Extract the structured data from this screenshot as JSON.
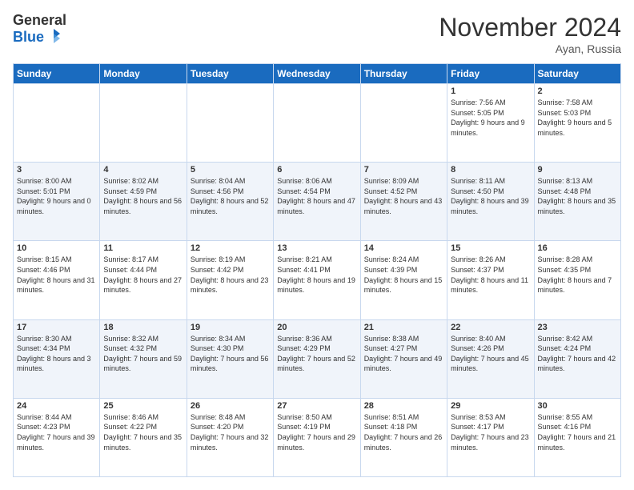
{
  "header": {
    "logo_general": "General",
    "logo_blue": "Blue",
    "title": "November 2024",
    "location": "Ayan, Russia"
  },
  "days_of_week": [
    "Sunday",
    "Monday",
    "Tuesday",
    "Wednesday",
    "Thursday",
    "Friday",
    "Saturday"
  ],
  "weeks": [
    [
      {
        "day": "",
        "info": ""
      },
      {
        "day": "",
        "info": ""
      },
      {
        "day": "",
        "info": ""
      },
      {
        "day": "",
        "info": ""
      },
      {
        "day": "",
        "info": ""
      },
      {
        "day": "1",
        "info": "Sunrise: 7:56 AM\nSunset: 5:05 PM\nDaylight: 9 hours and 9 minutes."
      },
      {
        "day": "2",
        "info": "Sunrise: 7:58 AM\nSunset: 5:03 PM\nDaylight: 9 hours and 5 minutes."
      }
    ],
    [
      {
        "day": "3",
        "info": "Sunrise: 8:00 AM\nSunset: 5:01 PM\nDaylight: 9 hours and 0 minutes."
      },
      {
        "day": "4",
        "info": "Sunrise: 8:02 AM\nSunset: 4:59 PM\nDaylight: 8 hours and 56 minutes."
      },
      {
        "day": "5",
        "info": "Sunrise: 8:04 AM\nSunset: 4:56 PM\nDaylight: 8 hours and 52 minutes."
      },
      {
        "day": "6",
        "info": "Sunrise: 8:06 AM\nSunset: 4:54 PM\nDaylight: 8 hours and 47 minutes."
      },
      {
        "day": "7",
        "info": "Sunrise: 8:09 AM\nSunset: 4:52 PM\nDaylight: 8 hours and 43 minutes."
      },
      {
        "day": "8",
        "info": "Sunrise: 8:11 AM\nSunset: 4:50 PM\nDaylight: 8 hours and 39 minutes."
      },
      {
        "day": "9",
        "info": "Sunrise: 8:13 AM\nSunset: 4:48 PM\nDaylight: 8 hours and 35 minutes."
      }
    ],
    [
      {
        "day": "10",
        "info": "Sunrise: 8:15 AM\nSunset: 4:46 PM\nDaylight: 8 hours and 31 minutes."
      },
      {
        "day": "11",
        "info": "Sunrise: 8:17 AM\nSunset: 4:44 PM\nDaylight: 8 hours and 27 minutes."
      },
      {
        "day": "12",
        "info": "Sunrise: 8:19 AM\nSunset: 4:42 PM\nDaylight: 8 hours and 23 minutes."
      },
      {
        "day": "13",
        "info": "Sunrise: 8:21 AM\nSunset: 4:41 PM\nDaylight: 8 hours and 19 minutes."
      },
      {
        "day": "14",
        "info": "Sunrise: 8:24 AM\nSunset: 4:39 PM\nDaylight: 8 hours and 15 minutes."
      },
      {
        "day": "15",
        "info": "Sunrise: 8:26 AM\nSunset: 4:37 PM\nDaylight: 8 hours and 11 minutes."
      },
      {
        "day": "16",
        "info": "Sunrise: 8:28 AM\nSunset: 4:35 PM\nDaylight: 8 hours and 7 minutes."
      }
    ],
    [
      {
        "day": "17",
        "info": "Sunrise: 8:30 AM\nSunset: 4:34 PM\nDaylight: 8 hours and 3 minutes."
      },
      {
        "day": "18",
        "info": "Sunrise: 8:32 AM\nSunset: 4:32 PM\nDaylight: 7 hours and 59 minutes."
      },
      {
        "day": "19",
        "info": "Sunrise: 8:34 AM\nSunset: 4:30 PM\nDaylight: 7 hours and 56 minutes."
      },
      {
        "day": "20",
        "info": "Sunrise: 8:36 AM\nSunset: 4:29 PM\nDaylight: 7 hours and 52 minutes."
      },
      {
        "day": "21",
        "info": "Sunrise: 8:38 AM\nSunset: 4:27 PM\nDaylight: 7 hours and 49 minutes."
      },
      {
        "day": "22",
        "info": "Sunrise: 8:40 AM\nSunset: 4:26 PM\nDaylight: 7 hours and 45 minutes."
      },
      {
        "day": "23",
        "info": "Sunrise: 8:42 AM\nSunset: 4:24 PM\nDaylight: 7 hours and 42 minutes."
      }
    ],
    [
      {
        "day": "24",
        "info": "Sunrise: 8:44 AM\nSunset: 4:23 PM\nDaylight: 7 hours and 39 minutes."
      },
      {
        "day": "25",
        "info": "Sunrise: 8:46 AM\nSunset: 4:22 PM\nDaylight: 7 hours and 35 minutes."
      },
      {
        "day": "26",
        "info": "Sunrise: 8:48 AM\nSunset: 4:20 PM\nDaylight: 7 hours and 32 minutes."
      },
      {
        "day": "27",
        "info": "Sunrise: 8:50 AM\nSunset: 4:19 PM\nDaylight: 7 hours and 29 minutes."
      },
      {
        "day": "28",
        "info": "Sunrise: 8:51 AM\nSunset: 4:18 PM\nDaylight: 7 hours and 26 minutes."
      },
      {
        "day": "29",
        "info": "Sunrise: 8:53 AM\nSunset: 4:17 PM\nDaylight: 7 hours and 23 minutes."
      },
      {
        "day": "30",
        "info": "Sunrise: 8:55 AM\nSunset: 4:16 PM\nDaylight: 7 hours and 21 minutes."
      }
    ]
  ]
}
